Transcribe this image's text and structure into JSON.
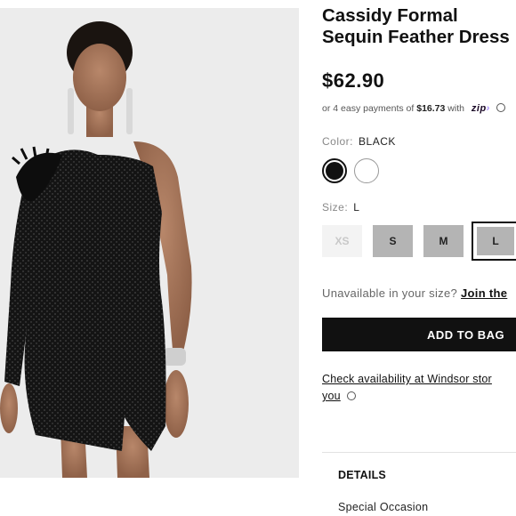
{
  "product": {
    "title_line1": "Cassidy Formal",
    "title_line2": "Sequin Feather Dress",
    "price": "$62.90"
  },
  "payments": {
    "prefix": "or 4 easy payments of",
    "amount": "$16.73",
    "suffix": "with",
    "provider": "zip"
  },
  "color": {
    "label": "Color:",
    "selected": "BLACK",
    "swatches": [
      "black",
      "white"
    ]
  },
  "size": {
    "label": "Size:",
    "selected": "L",
    "options": [
      "XS",
      "S",
      "M",
      "L"
    ]
  },
  "availability": {
    "question": "Unavailable in your size?",
    "link": "Join the"
  },
  "cart": {
    "add_label": "ADD TO BAG"
  },
  "store": {
    "line1": "Check availability at Windsor stor",
    "line2": "you"
  },
  "accordion": {
    "details_label": "DETAILS",
    "first_item": "Special Occasion"
  },
  "colors": {
    "primary": "#111111",
    "swatch_black": "#111111",
    "swatch_white": "#ffffff",
    "size_available": "#b4b4b4",
    "size_unavailable": "#f3f3f3",
    "zip_brand": "#aa8fff"
  }
}
